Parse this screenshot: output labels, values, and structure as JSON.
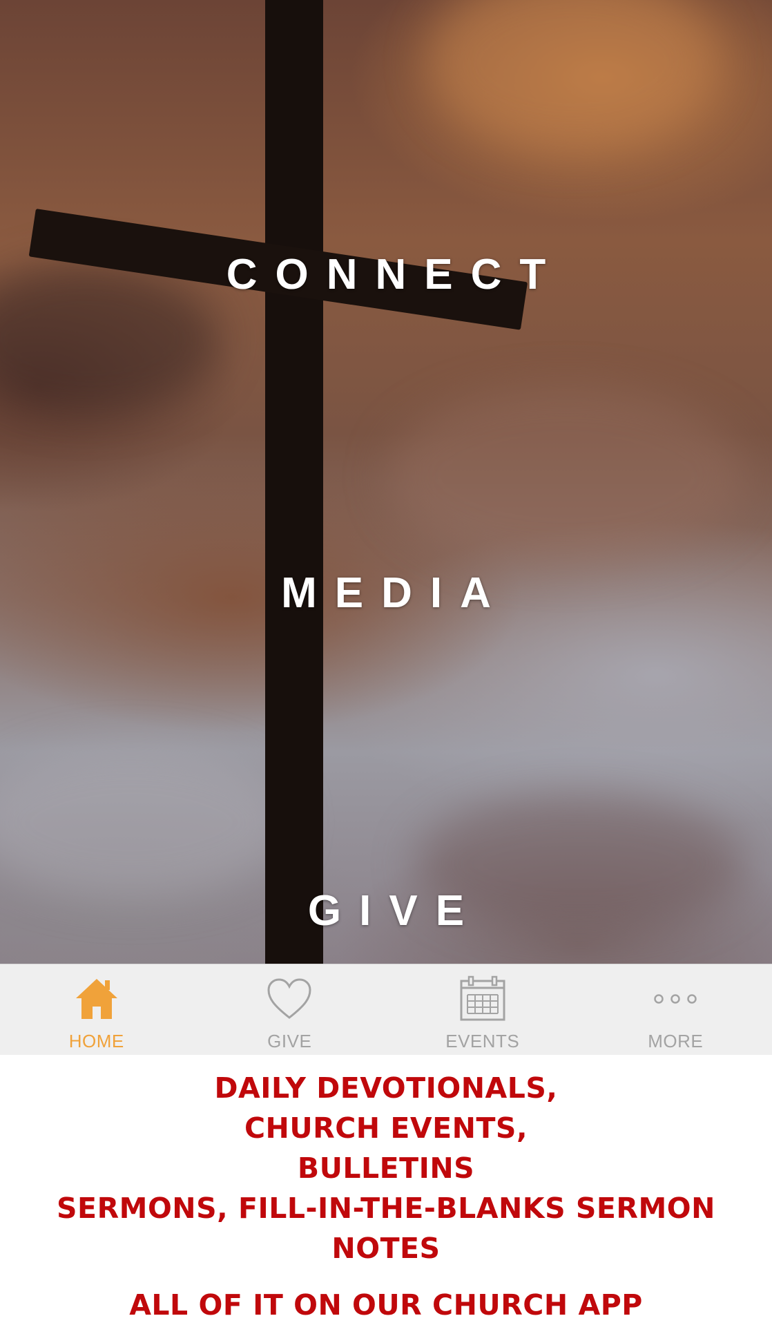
{
  "hero": {
    "links": [
      {
        "label": "CONNECT"
      },
      {
        "label": "MEDIA"
      },
      {
        "label": "GIVE"
      }
    ]
  },
  "tabbar": {
    "active_color": "#f0a23a",
    "inactive_color": "#a3a3a3",
    "tabs": [
      {
        "label": "HOME",
        "icon": "home-icon",
        "active": true
      },
      {
        "label": "GIVE",
        "icon": "heart-icon",
        "active": false
      },
      {
        "label": "EVENTS",
        "icon": "calendar-icon",
        "active": false
      },
      {
        "label": "MORE",
        "icon": "more-dots-icon",
        "active": false
      }
    ]
  },
  "promo": {
    "color": "#c0080b",
    "lines": [
      "DAILY DEVOTIONALS,",
      "CHURCH EVENTS,",
      "BULLETINS",
      "SERMONS, FILL-IN-THE-BLANKS SERMON NOTES"
    ],
    "closing": "ALL OF IT ON OUR CHURCH APP"
  }
}
